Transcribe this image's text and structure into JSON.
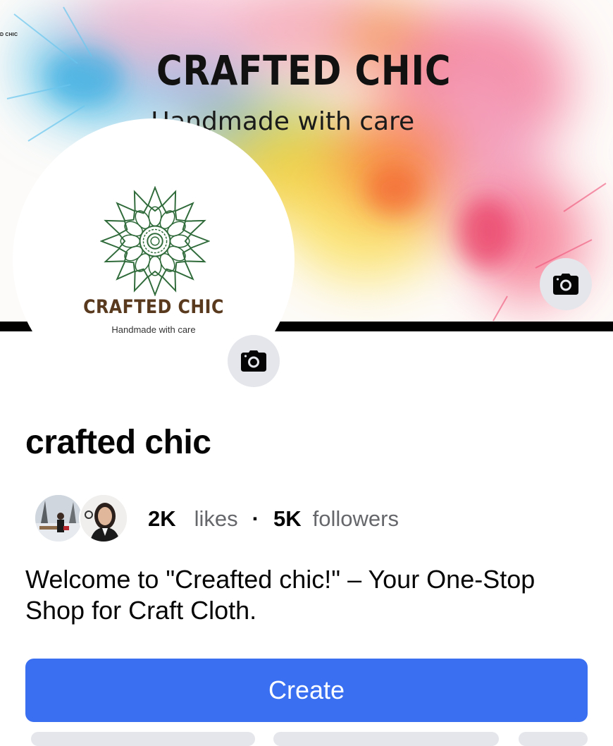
{
  "cover": {
    "corner_text": "D CHIC",
    "title": "CRAFTED CHIC",
    "subtitle": "Handmade with care",
    "camera_icon": "camera-icon"
  },
  "profile_picture": {
    "logo_name": "CRAFTED CHIC",
    "logo_tagline": "Handmade with care",
    "camera_icon": "camera-icon"
  },
  "page": {
    "name": "crafted chic",
    "stats": {
      "likes_count": "2K",
      "likes_label": "likes",
      "separator": "·",
      "followers_count": "5K",
      "followers_label": "followers"
    },
    "bio": "Welcome to \"Creafted chic!\" – Your One-Stop Shop for Craft Cloth."
  },
  "actions": {
    "create_label": "Create"
  },
  "colors": {
    "primary_button": "#3a6ff2",
    "secondary_text": "#65676b",
    "icon_button_bg": "#e4e6eb",
    "logo_green": "#2f6b3a",
    "logo_brown": "#5a3a1f"
  }
}
